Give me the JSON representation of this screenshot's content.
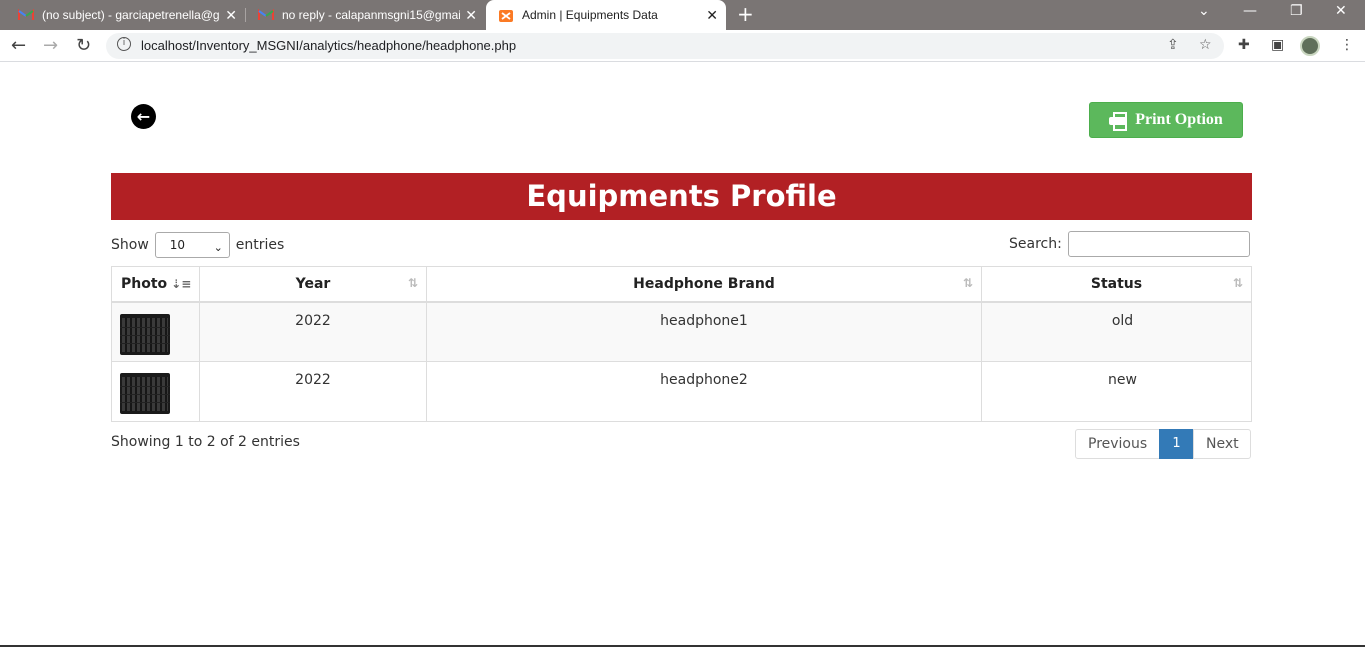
{
  "browser": {
    "tabs": [
      {
        "title": "(no subject) - garciapetrenella@g",
        "favicon": "gmail-icon"
      },
      {
        "title": "no reply - calapanmsgni15@gmai",
        "favicon": "gmail-icon"
      },
      {
        "title": "Admin | Equipments Data",
        "favicon": "xampp-icon",
        "active": true
      }
    ],
    "url": "localhost/Inventory_MSGNI/analytics/headphone/headphone.php"
  },
  "page": {
    "print_label": "Print Option",
    "banner_title": "Equipments Profile",
    "length": {
      "show": "Show",
      "value": "10",
      "entries": "entries"
    },
    "search_label": "Search:",
    "columns": [
      "Photo",
      "Year",
      "Headphone Brand",
      "Status"
    ],
    "rows": [
      {
        "year": "2022",
        "brand": "headphone1",
        "status": "old"
      },
      {
        "year": "2022",
        "brand": "headphone2",
        "status": "new"
      }
    ],
    "info": "Showing 1 to 2 of 2 entries",
    "pager": {
      "previous": "Previous",
      "current": "1",
      "next": "Next"
    }
  },
  "colors": {
    "banner": "#b22024",
    "print_button": "#5cb85c",
    "pager_active": "#337ab7"
  }
}
